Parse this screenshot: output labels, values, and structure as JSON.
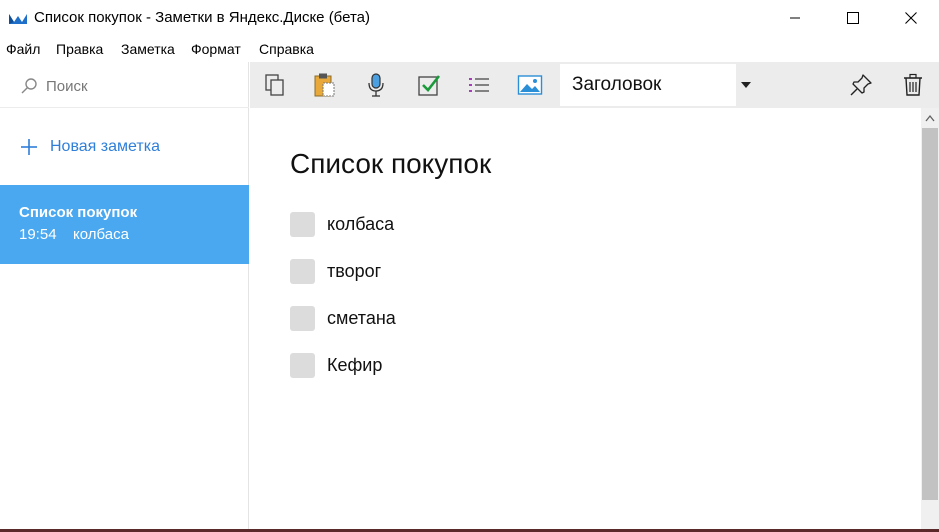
{
  "window": {
    "title": "Список покупок - Заметки в Яндекс.Диске (бета)"
  },
  "menu": {
    "items": [
      "Файл",
      "Правка",
      "Заметка",
      "Формат",
      "Справка"
    ]
  },
  "sidebar": {
    "search_placeholder": "Поиск",
    "new_note_label": "Новая заметка",
    "notes": [
      {
        "title": "Список покупок",
        "time": "19:54",
        "preview": "колбаса"
      }
    ]
  },
  "toolbar": {
    "heading_value": "Заголовок",
    "icons": [
      "copy-icon",
      "paste-icon",
      "microphone-icon",
      "checkbox-icon",
      "list-icon",
      "image-icon",
      "pin-icon",
      "trash-icon"
    ]
  },
  "note": {
    "title": "Список покупок",
    "items": [
      "колбаса",
      "творог",
      "сметана",
      "Кефир"
    ]
  },
  "colors": {
    "selected_note_bg": "#4aa8f0",
    "accent_blue": "#2f7fd9",
    "checkbox_green": "#1a9a3a",
    "list_purple": "#a43fb8",
    "image_blue": "#2a8fd6",
    "toolbar_bg": "#ececec"
  }
}
